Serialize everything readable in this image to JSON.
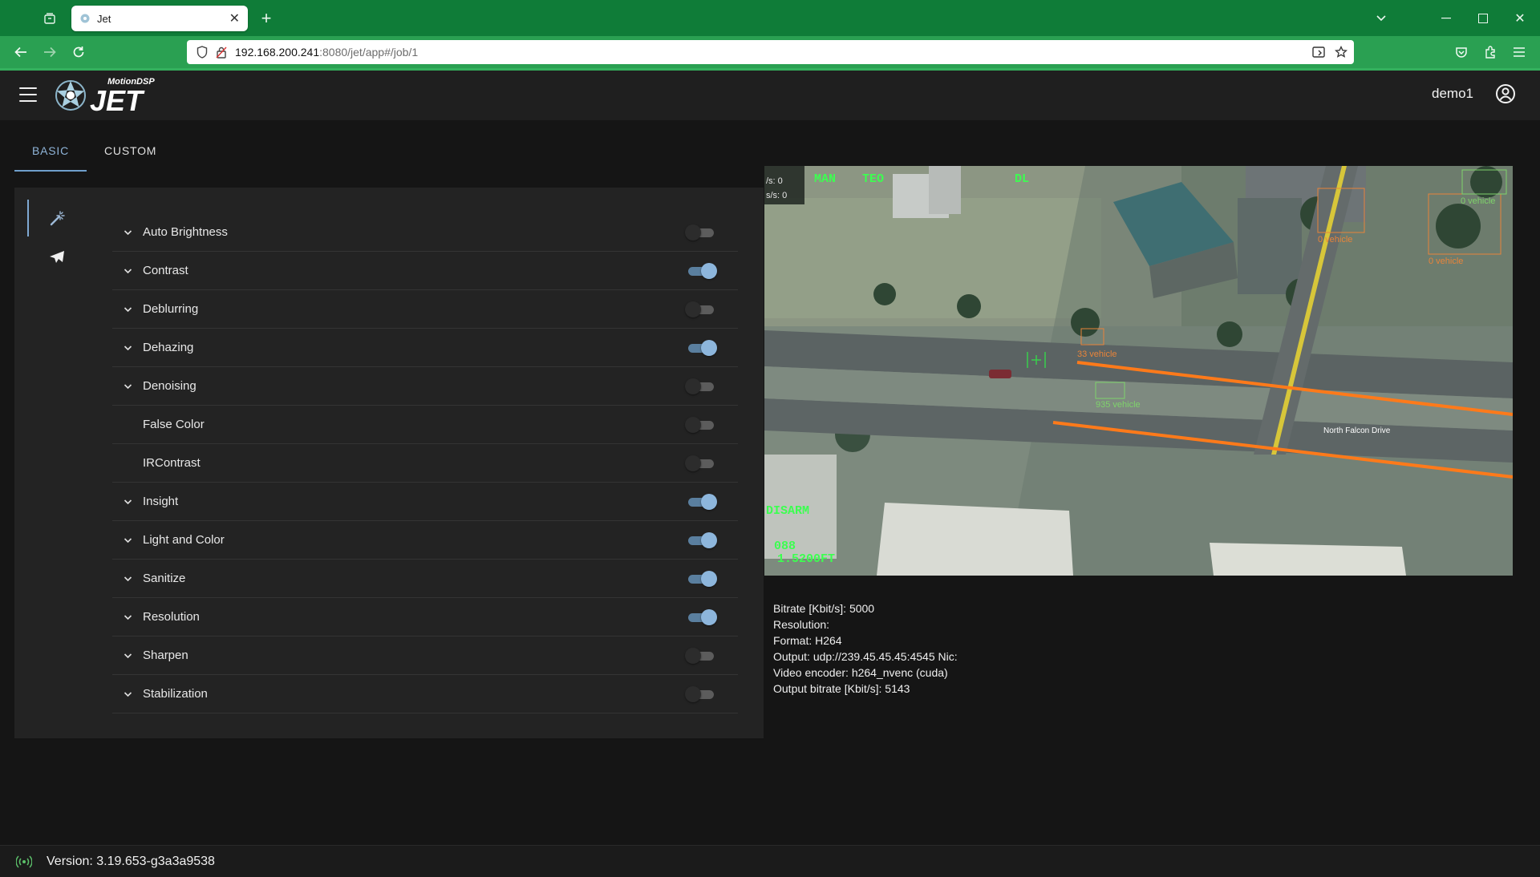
{
  "browser": {
    "tab_title": "Jet",
    "url_host": "192.168.200.241",
    "url_path": ":8080/jet/app#/job/1"
  },
  "header": {
    "logo_brand": "MotionDSP",
    "logo_product": "JET",
    "username": "demo1"
  },
  "tabs": [
    {
      "label": "BASIC",
      "active": true
    },
    {
      "label": "CUSTOM",
      "active": false
    }
  ],
  "filters": [
    {
      "label": "Auto Brightness",
      "expandable": true,
      "enabled": false
    },
    {
      "label": "Contrast",
      "expandable": true,
      "enabled": true
    },
    {
      "label": "Deblurring",
      "expandable": true,
      "enabled": false
    },
    {
      "label": "Dehazing",
      "expandable": true,
      "enabled": true
    },
    {
      "label": "Denoising",
      "expandable": true,
      "enabled": false
    },
    {
      "label": "False Color",
      "expandable": false,
      "enabled": false
    },
    {
      "label": "IRContrast",
      "expandable": false,
      "enabled": false
    },
    {
      "label": "Insight",
      "expandable": true,
      "enabled": true
    },
    {
      "label": "Light and Color",
      "expandable": true,
      "enabled": true
    },
    {
      "label": "Sanitize",
      "expandable": true,
      "enabled": true
    },
    {
      "label": "Resolution",
      "expandable": true,
      "enabled": true
    },
    {
      "label": "Sharpen",
      "expandable": true,
      "enabled": false
    },
    {
      "label": "Stabilization",
      "expandable": true,
      "enabled": false
    }
  ],
  "video": {
    "overlay_top_left": [
      "/s: 0",
      "s/s: 0"
    ],
    "hud_text": [
      "MAN",
      "TEO",
      "DL",
      "DISARM",
      "088",
      "1.5200FT"
    ],
    "detections": [
      {
        "label": "0 vehicle",
        "color": "#e8843a"
      },
      {
        "label": "0 vehicle",
        "color": "#7fd36b"
      },
      {
        "label": "0 vehicle",
        "color": "#e8843a"
      },
      {
        "label": "33 vehicle",
        "color": "#e8843a"
      },
      {
        "label": "935 vehicle",
        "color": "#7fd36b"
      }
    ],
    "street_label": "North Falcon Drive"
  },
  "stats": [
    {
      "label": "Bitrate [Kbit/s]:",
      "value": "5000"
    },
    {
      "label": "Resolution:",
      "value": ""
    },
    {
      "label": "Format:",
      "value": "H264"
    },
    {
      "label": "Output:",
      "value": "udp://239.45.45.45:4545 Nic:"
    },
    {
      "label": "Video encoder:",
      "value": "h264_nvenc (cuda)"
    },
    {
      "label": "Output bitrate [Kbit/s]:",
      "value": "5143"
    }
  ],
  "footer": {
    "version": "Version: 3.19.653-g3a3a9538"
  },
  "colors": {
    "accent": "#7fa9d3",
    "toggle_on": "#8db6dc",
    "chrome_green": "#0f7c38",
    "detection_orange": "#e8843a",
    "detection_green": "#7fd36b"
  }
}
